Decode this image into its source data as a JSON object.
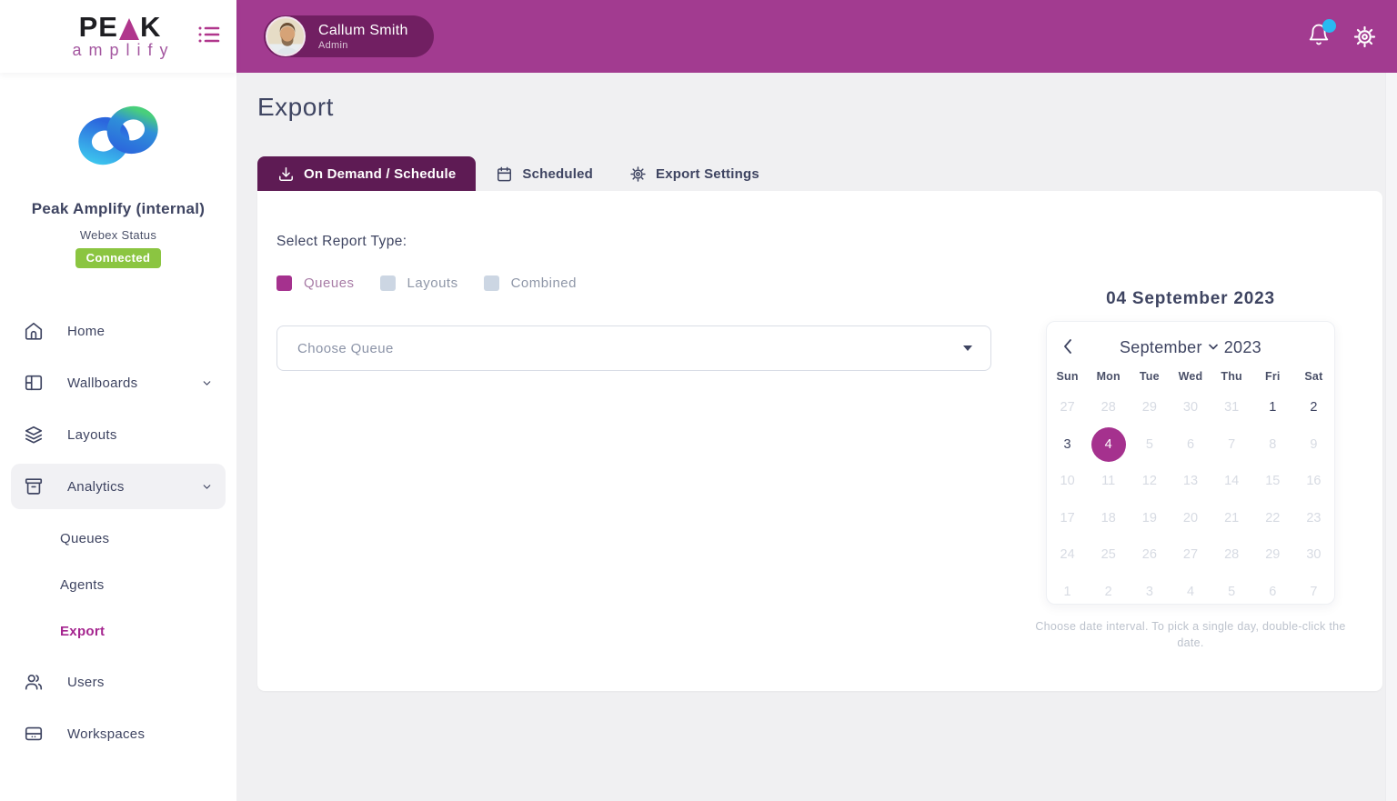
{
  "brand": {
    "peak_pre": "PE",
    "peak_post": "K",
    "sub": "amplify"
  },
  "header": {
    "user_name": "Callum Smith",
    "user_role": "Admin"
  },
  "sidebar": {
    "org_name": "Peak Amplify (internal)",
    "status_label": "Webex Status",
    "status_value": "Connected",
    "nav": {
      "home": "Home",
      "wallboards": "Wallboards",
      "layouts": "Layouts",
      "analytics": "Analytics",
      "queues": "Queues",
      "agents": "Agents",
      "export": "Export",
      "users": "Users",
      "workspaces": "Workspaces"
    }
  },
  "page": {
    "title": "Export"
  },
  "tabs": [
    {
      "label": "On Demand / Schedule",
      "active": true
    },
    {
      "label": "Scheduled",
      "active": false
    },
    {
      "label": "Export Settings",
      "active": false
    }
  ],
  "report_type": {
    "label": "Select Report Type:",
    "options": [
      {
        "label": "Queues",
        "checked": true
      },
      {
        "label": "Layouts",
        "checked": false
      },
      {
        "label": "Combined",
        "checked": false
      }
    ]
  },
  "queue_select": {
    "placeholder": "Choose Queue"
  },
  "calendar": {
    "title": "04 September 2023",
    "month": "September",
    "year": "2023",
    "weekdays": [
      "Sun",
      "Mon",
      "Tue",
      "Wed",
      "Thu",
      "Fri",
      "Sat"
    ],
    "days": [
      {
        "label": "27",
        "state": "out"
      },
      {
        "label": "28",
        "state": "out"
      },
      {
        "label": "29",
        "state": "out"
      },
      {
        "label": "30",
        "state": "out"
      },
      {
        "label": "31",
        "state": "out"
      },
      {
        "label": "1",
        "state": "on"
      },
      {
        "label": "2",
        "state": "on"
      },
      {
        "label": "3",
        "state": "on"
      },
      {
        "label": "4",
        "state": "sel"
      },
      {
        "label": "5",
        "state": "dis"
      },
      {
        "label": "6",
        "state": "dis"
      },
      {
        "label": "7",
        "state": "dis"
      },
      {
        "label": "8",
        "state": "dis"
      },
      {
        "label": "9",
        "state": "dis"
      },
      {
        "label": "10",
        "state": "dis"
      },
      {
        "label": "11",
        "state": "dis"
      },
      {
        "label": "12",
        "state": "dis"
      },
      {
        "label": "13",
        "state": "dis"
      },
      {
        "label": "14",
        "state": "dis"
      },
      {
        "label": "15",
        "state": "dis"
      },
      {
        "label": "16",
        "state": "dis"
      },
      {
        "label": "17",
        "state": "dis"
      },
      {
        "label": "18",
        "state": "dis"
      },
      {
        "label": "19",
        "state": "dis"
      },
      {
        "label": "20",
        "state": "dis"
      },
      {
        "label": "21",
        "state": "dis"
      },
      {
        "label": "22",
        "state": "dis"
      },
      {
        "label": "23",
        "state": "dis"
      },
      {
        "label": "24",
        "state": "dis"
      },
      {
        "label": "25",
        "state": "dis"
      },
      {
        "label": "26",
        "state": "dis"
      },
      {
        "label": "27",
        "state": "dis"
      },
      {
        "label": "28",
        "state": "dis"
      },
      {
        "label": "29",
        "state": "dis"
      },
      {
        "label": "30",
        "state": "dis"
      },
      {
        "label": "1",
        "state": "out"
      },
      {
        "label": "2",
        "state": "out"
      },
      {
        "label": "3",
        "state": "out"
      },
      {
        "label": "4",
        "state": "out"
      },
      {
        "label": "5",
        "state": "out"
      },
      {
        "label": "6",
        "state": "out"
      },
      {
        "label": "7",
        "state": "out"
      }
    ],
    "hint": "Choose date interval. To pick a single day, double-click the date."
  },
  "colors": {
    "topbar": "#a23b90",
    "accent_magenta": "#a5318e",
    "tab_active": "#5e1b54",
    "user_pill": "#711f62",
    "badge_green": "#8bc541",
    "notification_blue": "#29b9f2",
    "text_dark": "#3e4461",
    "muted_day": "#d7dbe3"
  }
}
